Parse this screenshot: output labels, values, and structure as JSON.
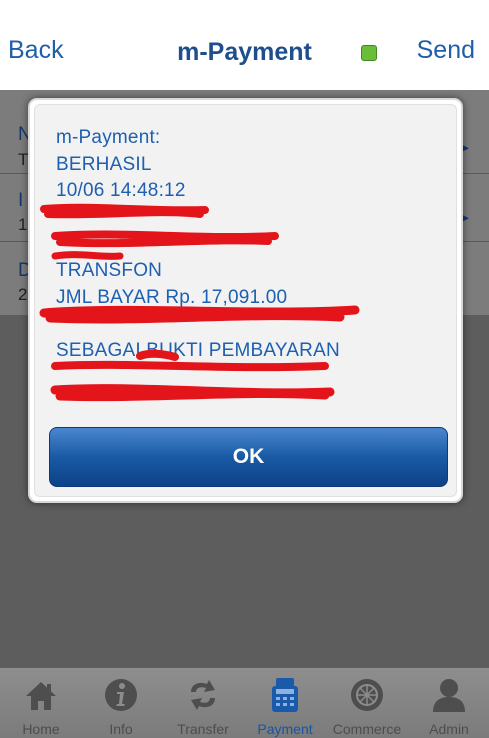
{
  "navbar": {
    "back_label": "Back",
    "title": "m-Payment",
    "send_label": "Send",
    "status_color": "#69bd38"
  },
  "background_list": {
    "rows": [
      {
        "key": "N",
        "value": "T"
      },
      {
        "key": "I",
        "value": "1"
      },
      {
        "key": "D",
        "value": "2"
      }
    ]
  },
  "dialog": {
    "lines": [
      "m-Payment:",
      "BERHASIL",
      "10/06 14:48:12",
      "",
      "",
      "TRANSFON",
      "JML BAYAR Rp. 17,091.00",
      "",
      "SEBAGAI BUKTI PEMBAYARAN",
      "",
      ""
    ],
    "ok_label": "OK"
  },
  "tabbar": {
    "active": "Payment",
    "items": [
      {
        "label": "Home",
        "icon": "home-icon"
      },
      {
        "label": "Info",
        "icon": "info-icon"
      },
      {
        "label": "Transfer",
        "icon": "transfer-icon"
      },
      {
        "label": "Payment",
        "icon": "payment-icon"
      },
      {
        "label": "Commerce",
        "icon": "commerce-icon"
      },
      {
        "label": "Admin",
        "icon": "admin-icon"
      }
    ]
  }
}
